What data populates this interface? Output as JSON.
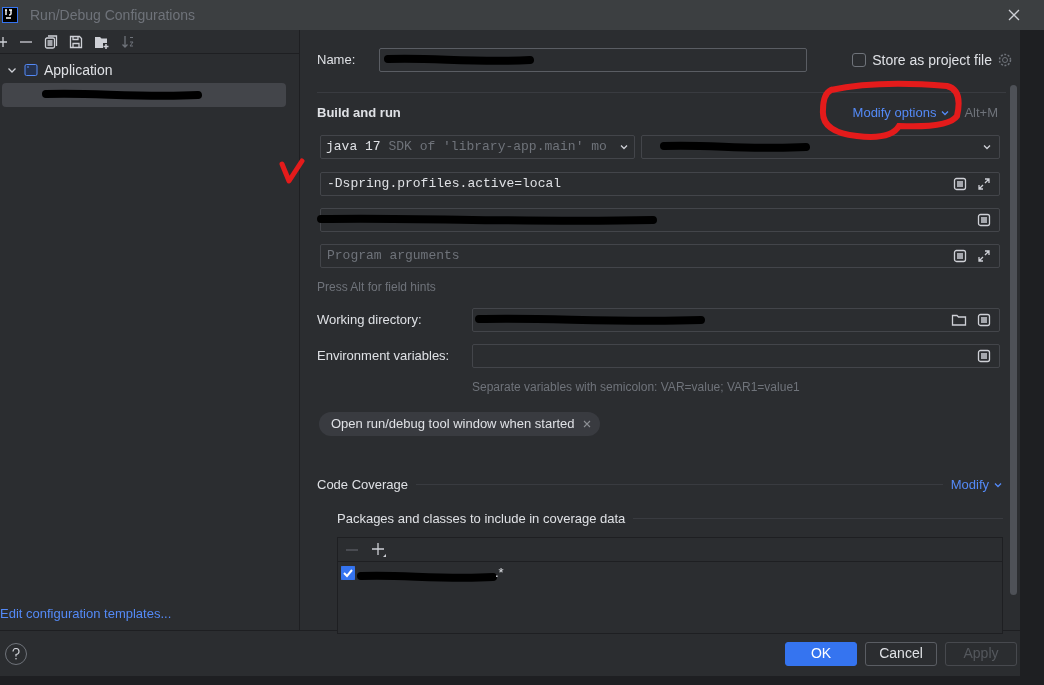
{
  "window": {
    "title": "Run/Debug Configurations"
  },
  "tree": [
    {
      "label": "Application",
      "expanded": true,
      "children": [
        {
          "kind": "redacted",
          "selected": true
        }
      ]
    }
  ],
  "edit_templates_link": "Edit configuration templates...",
  "name_field": {
    "label": "Name:"
  },
  "store_as_project_file": {
    "label": "Store as project file",
    "checked": false
  },
  "build_and_run": {
    "title": "Build and run",
    "modify_link": "Modify options",
    "shortcut": "Alt+M",
    "jre": {
      "value": "java 17",
      "detail": "SDK of 'library-app.main' mo"
    },
    "vm_options": {
      "value": "-Dspring.profiles.active=local"
    },
    "program_arguments": {
      "placeholder": "Program arguments"
    },
    "hint": "Press Alt for field hints"
  },
  "working_directory": {
    "label": "Working directory:"
  },
  "environment_variables": {
    "label": "Environment variables:",
    "hint": "Separate variables with semicolon: VAR=value; VAR1=value1"
  },
  "chips": [
    {
      "label": "Open run/debug tool window when started"
    }
  ],
  "code_coverage": {
    "title": "Code Coverage",
    "modify_link": "Modify",
    "packages_title": "Packages and classes to include in coverage data",
    "entries": [
      {
        "suffix": ".*",
        "checked": true
      }
    ]
  },
  "buttons": [
    {
      "label": "OK",
      "kind": "primary",
      "disabled": false
    },
    {
      "label": "Cancel",
      "kind": "default",
      "disabled": false
    },
    {
      "label": "Apply",
      "kind": "default",
      "disabled": true
    }
  ]
}
